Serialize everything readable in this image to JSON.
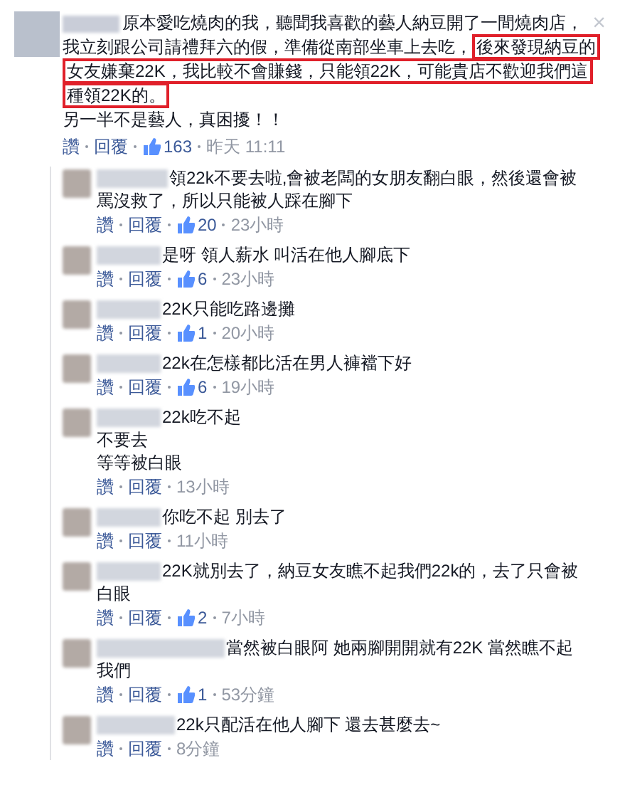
{
  "post": {
    "segments": [
      {
        "text": "原本愛吃燒肉的我，聽聞我喜歡的藝人納豆開了一間燒肉店，我立刻跟公司請禮拜六的假，準備從南部坐車上去吃，",
        "highlighted": false
      },
      {
        "text": "後來發現納豆的女友嫌棄22K，我比較不會賺錢，只能領22K，可能貴店不歡迎我們這種領22K的。",
        "highlighted": true
      }
    ],
    "second_line": "另一半不是藝人，真困擾！！",
    "actions": {
      "like": "讚",
      "reply": "回覆",
      "likes": "163",
      "time": "昨天 11:11"
    },
    "close": "×"
  },
  "replies": [
    {
      "lines": [
        "領22k不要去啦,會被老闆的女朋友翻白眼，然後還會被罵沒救了，所以只能被人踩在腳下"
      ],
      "like": "讚",
      "reply": "回覆",
      "likes": "20",
      "time": "23小時"
    },
    {
      "lines": [
        "是呀 領人薪水 叫活在他人腳底下"
      ],
      "like": "讚",
      "reply": "回覆",
      "likes": "6",
      "time": "23小時"
    },
    {
      "lines": [
        "22K只能吃路邊攤"
      ],
      "like": "讚",
      "reply": "回覆",
      "likes": "1",
      "time": "20小時"
    },
    {
      "lines": [
        "22k在怎樣都比活在男人褲襠下好"
      ],
      "like": "讚",
      "reply": "回覆",
      "likes": "6",
      "time": "19小時"
    },
    {
      "lines": [
        "22k吃不起",
        "不要去",
        "等等被白眼"
      ],
      "like": "讚",
      "reply": "回覆",
      "time": "13小時"
    },
    {
      "lines": [
        "你吃不起 別去了"
      ],
      "like": "讚",
      "reply": "回覆",
      "time": "11小時"
    },
    {
      "lines": [
        "22K就別去了，納豆女友瞧不起我們22k的，去了只會被白眼"
      ],
      "like": "讚",
      "reply": "回覆",
      "likes": "2",
      "time": "7小時"
    },
    {
      "lines": [
        "當然被白眼阿 她兩腳開開就有22K 當然瞧不起我們"
      ],
      "like": "讚",
      "reply": "回覆",
      "likes": "1",
      "time": "53分鐘"
    },
    {
      "lines": [
        "22k只配活在他人腳下 還去甚麼去~"
      ],
      "like": "讚",
      "reply": "回覆",
      "time": "8分鐘"
    }
  ]
}
